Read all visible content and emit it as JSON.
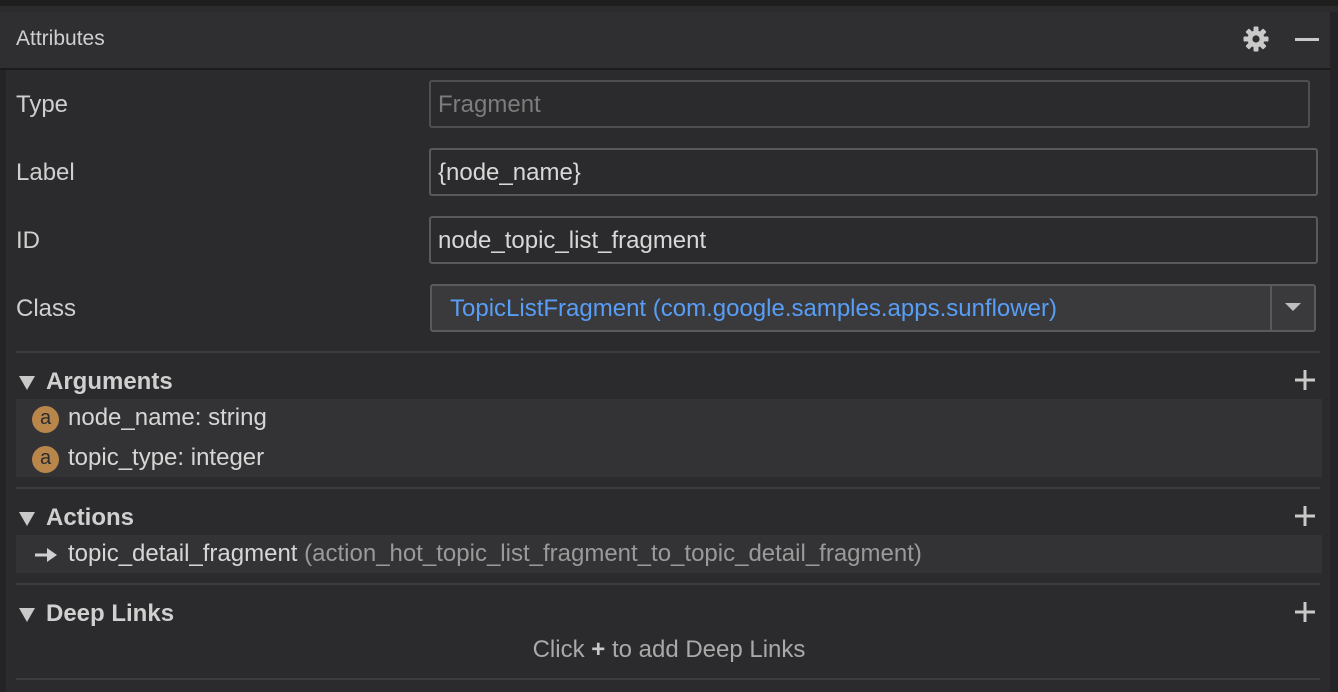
{
  "header": {
    "title": "Attributes",
    "settings_icon": "gear-icon",
    "minimize_icon": "minus-icon"
  },
  "properties": {
    "type": {
      "label": "Type",
      "value": "Fragment"
    },
    "label": {
      "label": "Label",
      "value": "{node_name}"
    },
    "id": {
      "label": "ID",
      "value": "node_topic_list_fragment"
    },
    "class": {
      "label": "Class",
      "value": "TopicListFragment (com.google.samples.apps.sunflower)"
    }
  },
  "sections": {
    "arguments": {
      "title": "Arguments",
      "items": [
        {
          "badge": "a",
          "text": "node_name: string"
        },
        {
          "badge": "a",
          "text": "topic_type: integer"
        }
      ]
    },
    "actions": {
      "title": "Actions",
      "items": [
        {
          "name": "topic_detail_fragment",
          "id": "(action_hot_topic_list_fragment_to_topic_detail_fragment)"
        }
      ]
    },
    "deep_links": {
      "title": "Deep Links",
      "hint_before": "Click",
      "hint_plus": "+",
      "hint_after": "to add Deep Links"
    }
  },
  "colors": {
    "background": "#2b2b2d",
    "link_blue": "#589df6",
    "argument_badge": "#b8864b"
  }
}
